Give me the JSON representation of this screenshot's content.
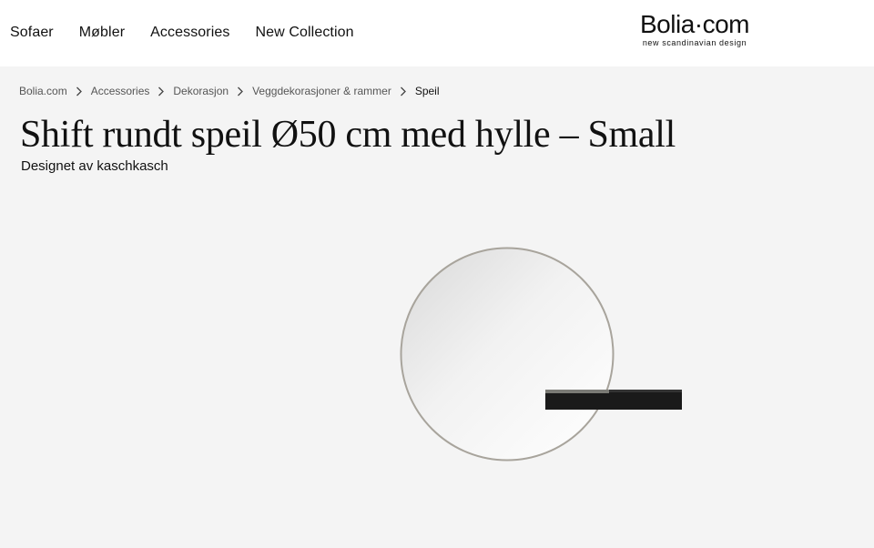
{
  "header": {
    "nav": [
      "Sofaer",
      "Møbler",
      "Accessories",
      "New Collection"
    ],
    "logo": {
      "name": "Bolia·com",
      "tagline": "new scandinavian design"
    }
  },
  "breadcrumb": [
    "Bolia.com",
    "Accessories",
    "Dekorasjon",
    "Veggdekorasjoner & rammer",
    "Speil"
  ],
  "product": {
    "title": "Shift rundt speil Ø50 cm med hylle – Small",
    "designer": "Designet av kaschkasch",
    "image_icon": "round-mirror-with-shelf"
  },
  "colors": {
    "header_bg": "#ffffff",
    "page_bg": "#f4f4f4",
    "shelf": "#1a1a1a",
    "mirror_frame": "#a8a49c"
  }
}
